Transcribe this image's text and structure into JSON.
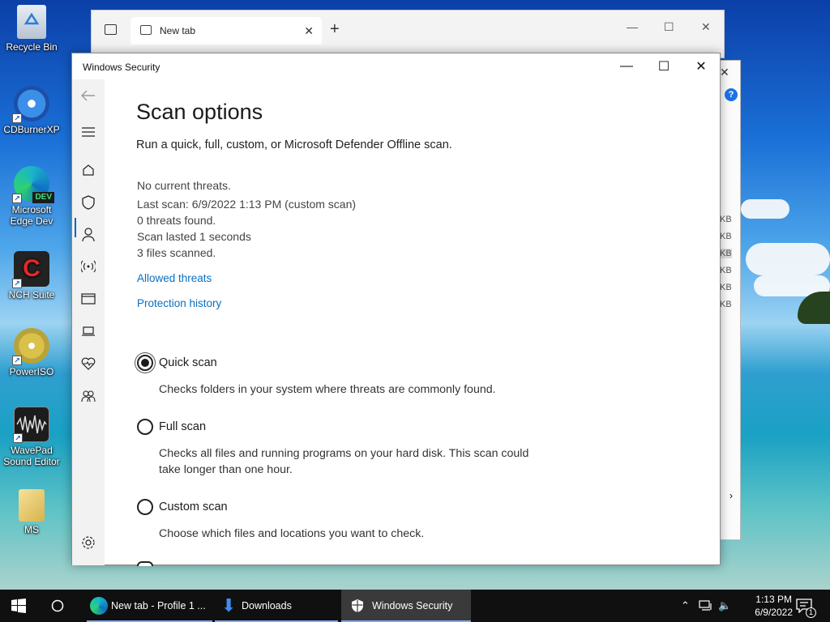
{
  "desktop": {
    "icons": [
      {
        "label": "Recycle Bin",
        "icon": "recycle-bin-icon"
      },
      {
        "label": "CDBurnerXP",
        "icon": "cdburnerxp-icon"
      },
      {
        "label": "Microsoft Edge Dev",
        "icon": "edge-dev-icon",
        "badge": "DEV"
      },
      {
        "label": "NCH Suite",
        "icon": "nch-suite-icon"
      },
      {
        "label": "PowerISO",
        "icon": "poweriso-icon"
      },
      {
        "label": "WavePad Sound Editor",
        "icon": "wavepad-icon"
      },
      {
        "label": "MS",
        "icon": "folder-icon"
      }
    ]
  },
  "browser": {
    "tab_label": "New tab",
    "kb_labels": [
      "KB",
      "KB",
      "KB",
      "KB",
      "KB",
      "KB"
    ]
  },
  "security_window": {
    "title": "Windows Security",
    "page_title": "Scan options",
    "subtitle": "Run a quick, full, custom, or Microsoft Defender Offline scan.",
    "status_lines": [
      "No current threats.",
      "Last scan: 6/9/2022 1:13 PM (custom scan)",
      "0 threats found.",
      "Scan lasted 1 seconds",
      "3 files scanned."
    ],
    "links": [
      "Allowed threats",
      "Protection history"
    ],
    "options": [
      {
        "label": "Quick scan",
        "description": "Checks folders in your system where threats are commonly found.",
        "selected": true
      },
      {
        "label": "Full scan",
        "description": "Checks all files and running programs on your hard disk. This scan could take longer than one hour.",
        "selected": false
      },
      {
        "label": "Custom scan",
        "description": "Choose which files and locations you want to check.",
        "selected": false
      }
    ],
    "sidebar": [
      "back-icon",
      "menu-icon",
      "home-icon",
      "shield-icon",
      "account-icon",
      "firewall-icon",
      "app-browser-icon",
      "device-security-icon",
      "health-icon",
      "family-icon",
      "settings-icon"
    ]
  },
  "taskbar": {
    "tasks": [
      {
        "label": "New tab - Profile 1 ...",
        "icon": "edge-dev-icon"
      },
      {
        "label": "Downloads",
        "icon": "downloads-icon"
      },
      {
        "label": "Windows Security",
        "icon": "shield-icon"
      }
    ],
    "time": "1:13 PM",
    "date": "6/9/2022",
    "notification_count": "1"
  },
  "colors": {
    "accent": "#0067c0",
    "link": "#0a6fc2",
    "taskbar": "#101010"
  }
}
